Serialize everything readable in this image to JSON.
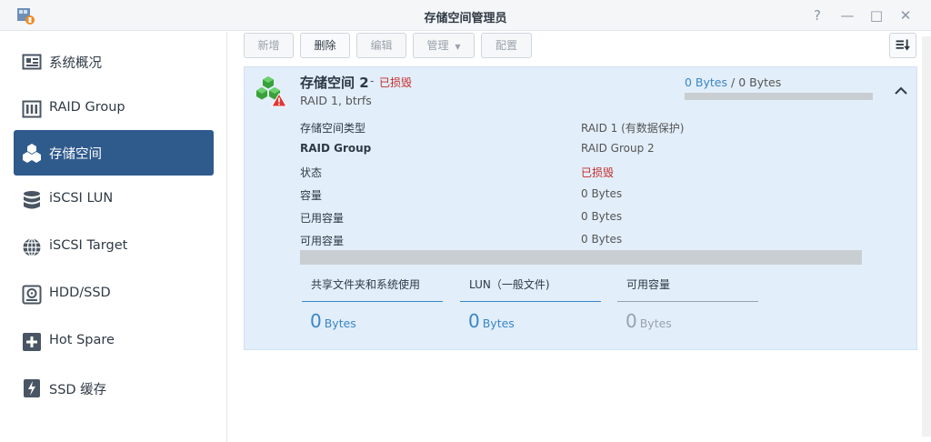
{
  "window": {
    "title": "存储空间管理员",
    "controls": {
      "help": "?",
      "minimize": "—",
      "maximize": "□",
      "close": "✕"
    }
  },
  "sidebar": {
    "items": [
      {
        "label": "系统概况",
        "icon": "overview-icon",
        "active": false
      },
      {
        "label": "RAID Group",
        "icon": "raid-group-icon",
        "active": false
      },
      {
        "label": "存储空间",
        "icon": "storage-volume-icon",
        "active": true
      },
      {
        "label": "iSCSI LUN",
        "icon": "database-icon",
        "active": false
      },
      {
        "label": "iSCSI Target",
        "icon": "globe-icon",
        "active": false
      },
      {
        "label": "HDD/SSD",
        "icon": "hdd-icon",
        "active": false
      },
      {
        "label": "Hot Spare",
        "icon": "plus-square-icon",
        "active": false
      },
      {
        "label": "SSD 缓存",
        "icon": "lightning-icon",
        "active": false
      }
    ]
  },
  "toolbar": {
    "create": "新增",
    "delete": "删除",
    "edit": "编辑",
    "manage": "管理",
    "configure": "配置"
  },
  "volume": {
    "title": "存储空间 2",
    "separator": "-",
    "status": "已损毁",
    "subtitle": "RAID 1, btrfs",
    "usage_used": "0 Bytes",
    "usage_sep": "/",
    "usage_total": "0 Bytes",
    "usage_fraction": 0,
    "properties": [
      {
        "label": "存储空间类型",
        "value": "RAID 1 (有数据保护)",
        "bold": false,
        "error": false
      },
      {
        "label": "RAID Group",
        "value": "RAID Group 2",
        "bold": true,
        "error": false
      },
      {
        "label": "状态",
        "value": "已损毁",
        "bold": false,
        "error": true
      },
      {
        "label": "容量",
        "value": "0 Bytes",
        "bold": false,
        "error": false
      },
      {
        "label": "已用容量",
        "value": "0 Bytes",
        "bold": false,
        "error": false
      },
      {
        "label": "可用容量",
        "value": "0 Bytes",
        "bold": false,
        "error": false
      }
    ],
    "tabs": [
      {
        "label": "共享文件夹和系统使用",
        "value": "0",
        "unit": "Bytes",
        "color": "#3a86c8"
      },
      {
        "label": "LUN（一般文件)",
        "value": "0",
        "unit": "Bytes",
        "color": "#3a86c8"
      },
      {
        "label": "可用容量",
        "value": "0",
        "unit": "Bytes",
        "color": "#9aa3ac"
      }
    ]
  },
  "colors": {
    "accent": "#2f5a8c",
    "error": "#c42a2a",
    "link": "#3a86c8",
    "panel": "#e2eef9"
  }
}
